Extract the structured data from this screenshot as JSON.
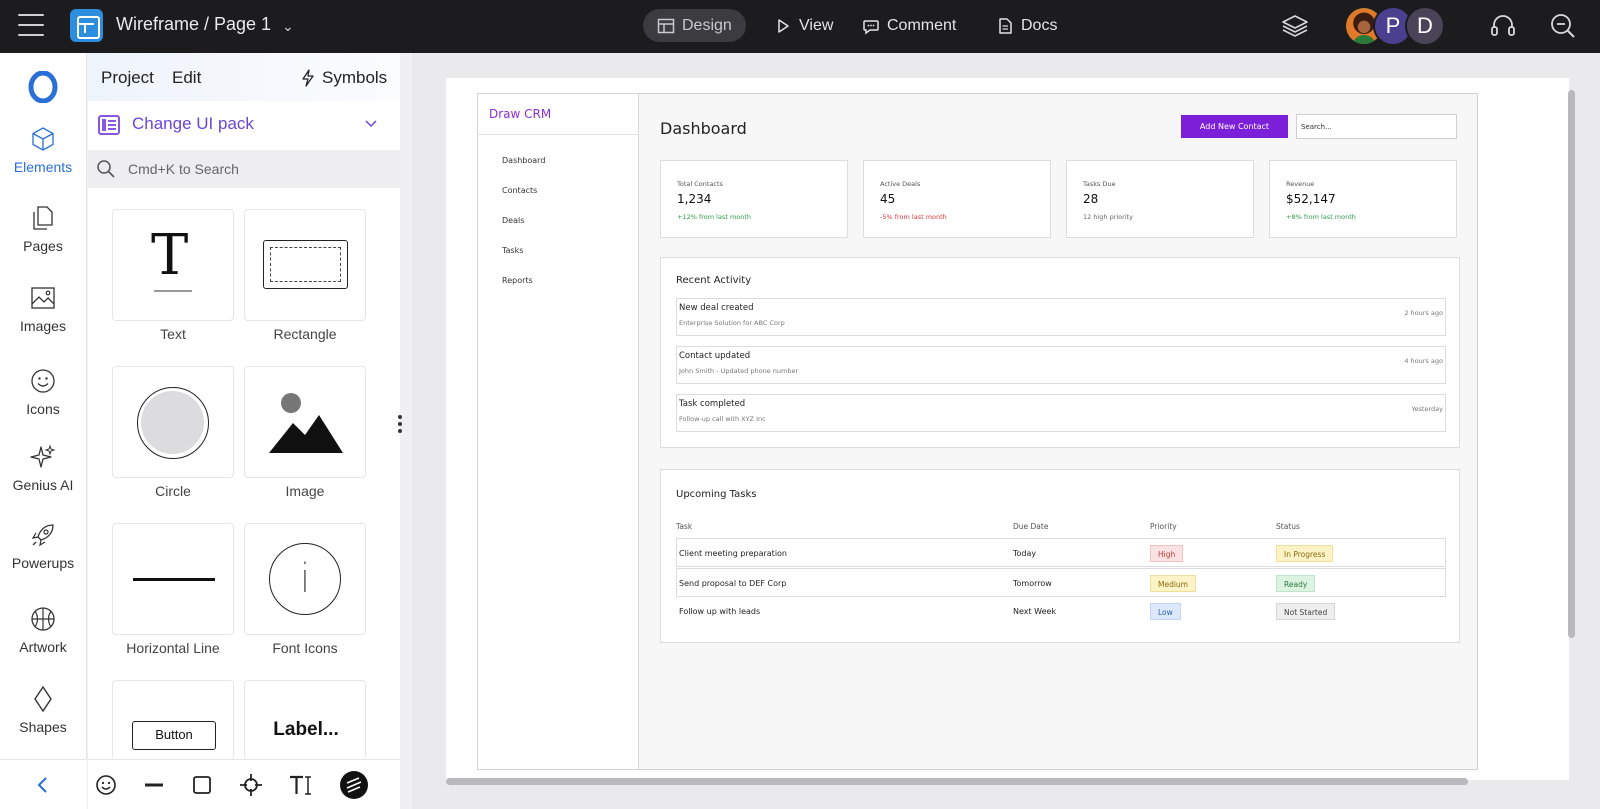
{
  "topbar": {
    "doc_title": "Wireframe / Page 1",
    "modes": [
      {
        "label": "Design",
        "icon": "layout-icon",
        "active": true
      },
      {
        "label": "View",
        "icon": "play-icon"
      },
      {
        "label": "Comment",
        "icon": "comment-icon"
      },
      {
        "label": "Docs",
        "icon": "doc-icon"
      }
    ],
    "avatars": [
      "P",
      "D"
    ]
  },
  "rail": {
    "items": [
      {
        "label": "Elements",
        "icon": "cube-icon",
        "active": true
      },
      {
        "label": "Pages",
        "icon": "pages-icon"
      },
      {
        "label": "Images",
        "icon": "images-icon"
      },
      {
        "label": "Icons",
        "icon": "smiley-icon"
      },
      {
        "label": "Genius AI",
        "icon": "sparkle-icon"
      },
      {
        "label": "Powerups",
        "icon": "rocket-icon"
      },
      {
        "label": "Artwork",
        "icon": "basketball-icon"
      },
      {
        "label": "Shapes",
        "icon": "diamond-icon"
      }
    ]
  },
  "panel": {
    "tabs": [
      "Project",
      "Edit"
    ],
    "symbols_label": "Symbols",
    "ui_pack_label": "Change UI pack",
    "search_placeholder": "Cmd+K to Search",
    "tiles": [
      {
        "label": "Text",
        "glyph": "T"
      },
      {
        "label": "Rectangle"
      },
      {
        "label": "Circle"
      },
      {
        "label": "Image"
      },
      {
        "label": "Horizontal Line"
      },
      {
        "label": "Font Icons",
        "glyph": "i"
      },
      {
        "label": "",
        "glyph": "Button"
      },
      {
        "label": "",
        "glyph": "Label..."
      }
    ]
  },
  "wireframe": {
    "brand": "Draw CRM",
    "nav": [
      "Dashboard",
      "Contacts",
      "Deals",
      "Tasks",
      "Reports"
    ],
    "title": "Dashboard",
    "add_button": "Add New Contact",
    "search_placeholder": "Search...",
    "stats": [
      {
        "title": "Total Contacts",
        "value": "1,234",
        "sub": "+12% from last month",
        "color": "#2ea04a"
      },
      {
        "title": "Active Deals",
        "value": "45",
        "sub": "-5% from last month",
        "color": "#d63a3a"
      },
      {
        "title": "Tasks Due",
        "value": "28",
        "sub": "12 high priority",
        "color": "#666666"
      },
      {
        "title": "Revenue",
        "value": "$52,147",
        "sub": "+8% from last month",
        "color": "#2ea04a"
      }
    ],
    "recent_activity": {
      "title": "Recent Activity",
      "items": [
        {
          "title": "New deal created",
          "detail": "Enterprise Solution for ABC Corp",
          "time": "2 hours ago"
        },
        {
          "title": "Contact updated",
          "detail": "John Smith - Updated phone number",
          "time": "4 hours ago"
        },
        {
          "title": "Task completed",
          "detail": "Follow-up call with XYZ Inc",
          "time": "Yesterday"
        }
      ]
    },
    "tasks": {
      "title": "Upcoming Tasks",
      "columns": [
        "Task",
        "Due Date",
        "Priority",
        "Status"
      ],
      "rows": [
        {
          "task": "Client meeting preparation",
          "due": "Today",
          "priority": "High",
          "status": "In Progress"
        },
        {
          "task": "Send proposal to DEF Corp",
          "due": "Tomorrow",
          "priority": "Medium",
          "status": "Ready"
        },
        {
          "task": "Follow up with leads",
          "due": "Next Week",
          "priority": "Low",
          "status": "Not Started"
        }
      ]
    }
  },
  "colors": {
    "accent": "#7b1fd9",
    "rail_active": "#2a6fd6",
    "priority_high": "#fbe2e2",
    "priority_medium": "#fdf3c6",
    "priority_low": "#dde9fb",
    "status_progress": "#fdf3c6",
    "status_ready": "#dcf3e1",
    "status_not_started": "#eeeeef"
  }
}
